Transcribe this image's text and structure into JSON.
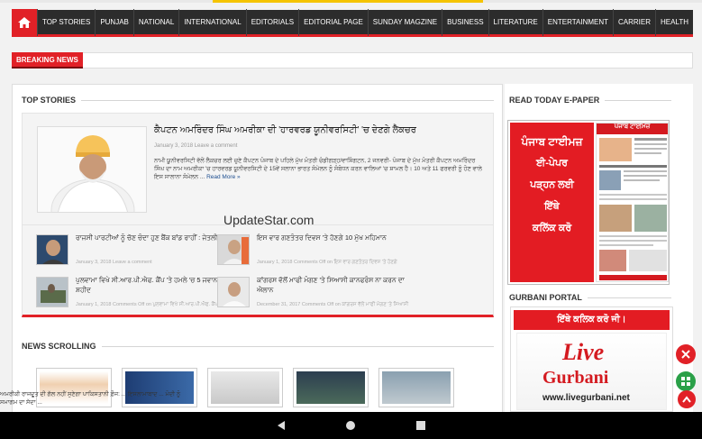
{
  "nav": {
    "home_icon": "home-icon",
    "items": [
      "TOP STORIES",
      "PUNJAB",
      "NATIONAL",
      "INTERNATIONAL",
      "EDITORIALS",
      "EDITORIAL PAGE",
      "SUNDAY MAGZINE",
      "BUSINESS",
      "LITERATURE",
      "ENTERTAINMENT",
      "CARRIER",
      "HEALTH"
    ]
  },
  "breaking": {
    "label": "BREAKING NEWS"
  },
  "top_stories": {
    "heading": "TOP STORIES",
    "featured": {
      "title": "ਕੈਪਟਨ ਅਮਰਿੰਦਰ ਸਿੰਘ ਅਮਰੀਕਾ ਦੀ 'ਹਾਰਵਰਡ ਯੂਨੀਵਰਸਿਟੀ' 'ਚ ਦੇਣਗੇ ਲੈਕਚਰ",
      "meta": "January 3, 2018 Leave a comment",
      "excerpt": "ਨਾਮੀ ਯੂਨੀਵਰਸਿਟੀ ਵੱਲੋਂ ਲੈਕਚਰ ਲਈ ਚੁਣੇ ਕੈਪਟਨ ਪੰਜਾਬ ਦੇ ਪਹਿਲੇ ਮੁੱਖ ਮੰਤਰੀ ਚੰਡੀਗੜ੍ਹ/ਵਾਸ਼ਿੰਗਟਨ, 2 ਜਨਵਰੀ- ਪੰਜਾਬ ਦੇ ਮੁੱਖ ਮੰਤਰੀ ਕੈਪਟਨ ਅਮਰਿੰਦਰ ਸਿੰਘ ਦਾ ਨਾਮ ਅਮਰੀਕਾ 'ਚ ਹਾਰਵਰਡ ਯੂਨੀਵਰਸਿਟੀ ਦੇ 15ਵੇਂ ਸਲਾਨਾ ਭਾਰਤ ਸੰਮੇਲਨ ਨੂੰ ਸੰਬੋਧਨ ਕਰਨ ਵਾਲਿਆਂ 'ਚ ਸ਼ਾਮਲ ਹੈ। 10 ਅਤੇ 11 ਫਰਵਰੀ ਨੂੰ ਹੋਣ ਵਾਲੇ ਇਸ ਸਾਲਾਨਾ ਸੰਮੇਲਨ ...",
      "read_more": "Read More »"
    },
    "items": [
      {
        "title": "ਰਾਜਸੀ ਪਾਰਟੀਆਂ ਨੂੰ ਚੋਣ ਚੰਦਾ ਹੁਣ ਬੈਂਕ ਬਾਂਡ ਰਾਹੀਂ : ਜੇਤਲੀ",
        "meta": "January 3, 2018 Leave a comment"
      },
      {
        "title": "ਇਸ ਵਾਰ ਗਣਤੰਤਰ ਦਿਵਸ 'ਤੇ ਹੋਣਗੇ 10 ਮੁੱਖ ਮਹਿਮਾਨ",
        "meta": "January 1, 2018 Comments Off on ਇਸ ਵਾਰ ਗਣਤੰਤਰ ਦਿਵਸ 'ਤੇ ਹੋਣਗੇ"
      },
      {
        "title": "ਪੁਲਵਾਮਾ ਵਿਖੇ ਸੀ.ਆਰ.ਪੀ.ਐਫ. ਕੈਂਪ 'ਤੇ ਹਮਲੇ 'ਚ 5 ਜਵਾਨ ਸ਼ਹੀਦ",
        "meta": "January 1, 2018 Comments Off on ਪੁਲਵਾਮਾ ਵਿਖੇ ਸੀ.ਆਰ.ਪੀ.ਐਫ. ਕੈਂਪ"
      },
      {
        "title": "ਕਾਂਗਰਸ ਵੱਲੋਂ ਮਾਫੀ ਮੰਗਣ 'ਤੇ ਸਿਆਸੀ ਕਾਨਫਰੰਸ ਨਾ ਕਰਨ ਦਾ ਐਲਾਨ",
        "meta": "December 31, 2017 Comments Off on ਕਾਂਗਰਸ ਵੱਲੋਂ ਮਾਫੀ ਮੰਗਣ 'ਤੇ ਸਿਆਸੀ"
      }
    ]
  },
  "watermark": "UpdateStar.com",
  "news_scrolling": {
    "heading": "NEWS SCROLLING",
    "ticker": "ਅਮਰੀਕੀ ਰਾਜਦੂਤ ਦੀ ਗੱਲ ਨਹੀਂ ਸੁਣੇਗਾ ਪਾਕਿਸਤਾਨੀ ਫ਼ੌਜ: ... ਇਸਲਾਮਾਬਾਦ ... ਮੋਦੀ ਨੂੰ ਸਮਾਗਮ ਦਾ ਸੱਦਾ ..."
  },
  "sidebar": {
    "epaper_heading": "READ TODAY E-PAPER",
    "epaper_title": "ਪੰਜਾਬ ਟਾਈਮਜ਼",
    "epaper_lines": [
      "ਈ-ਪੇਪਰ",
      "ਪੜ੍ਹਨ ਲਈ",
      "ਇੱਥੇ",
      "ਕਲਿੱਕ ਕਰੋ"
    ],
    "epaper_masthead": "ਪੰਜਾਬ ਟਾਈਮਜ਼",
    "gurbani_heading": "GURBANI PORTAL",
    "gurbani_click": "ਇੱਥੇ ਕਲਿਕ ਕਰੋ ਜੀ।",
    "gurbani_logo_big": "Live",
    "gurbani_logo_sub": "Gurbani",
    "gurbani_url": "www.livegurbani.net"
  },
  "colors": {
    "accent": "#e12127",
    "nav_bg": "#2c2c2c",
    "whatsapp": "#2aa048"
  }
}
